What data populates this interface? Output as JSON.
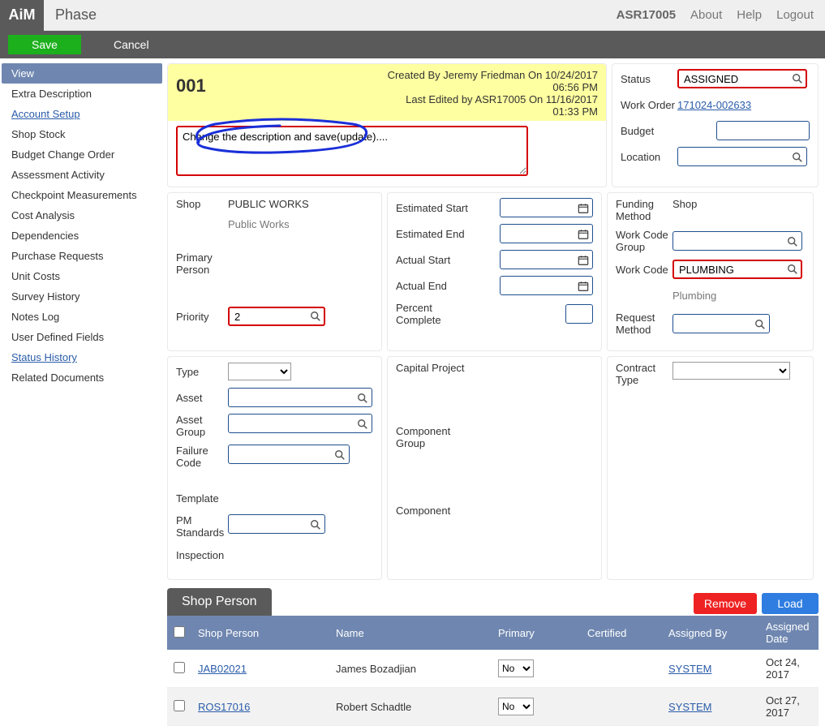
{
  "app": {
    "logo_a": "Ai",
    "logo_b": "M",
    "title": "Phase"
  },
  "top": {
    "user": "ASR17005",
    "about": "About",
    "help": "Help",
    "logout": "Logout"
  },
  "actions": {
    "save": "Save",
    "cancel": "Cancel"
  },
  "sidebar": {
    "view": "View",
    "items": [
      "Extra Description",
      "Account Setup",
      "Shop Stock",
      "Budget Change Order",
      "Assessment Activity",
      "Checkpoint Measurements",
      "Cost Analysis",
      "Dependencies",
      "Purchase Requests",
      "Unit Costs",
      "Survey History",
      "Notes Log",
      "User Defined Fields",
      "Status History",
      "Related Documents"
    ],
    "link_idx": [
      1,
      13
    ]
  },
  "header": {
    "phase": "001",
    "created": "Created By Jeremy Friedman On 10/24/2017",
    "created_time": "06:56 PM",
    "edited": "Last Edited by ASR17005 On 11/16/2017",
    "edited_time": "01:33 PM",
    "description": "Change the description and save(update)...."
  },
  "status_panel": {
    "status_lbl": "Status",
    "status_val": "ASSIGNED",
    "wo_lbl": "Work Order",
    "wo_val": "171024-002633",
    "budget_lbl": "Budget",
    "location_lbl": "Location"
  },
  "shop_panel": {
    "shop_lbl": "Shop",
    "shop_val": "PUBLIC WORKS",
    "shop_sub": "Public Works",
    "primary_lbl": "Primary Person",
    "priority_lbl": "Priority",
    "priority_val": "2"
  },
  "dates_panel": {
    "est_start": "Estimated Start",
    "est_end": "Estimated End",
    "act_start": "Actual Start",
    "act_end": "Actual End",
    "pct": "Percent Complete"
  },
  "funding_panel": {
    "funding_lbl": "Funding Method",
    "funding_val": "Shop",
    "wcg_lbl": "Work Code Group",
    "wc_lbl": "Work Code",
    "wc_val": "PLUMBING",
    "wc_sub": "Plumbing",
    "req_lbl": "Request Method"
  },
  "type_panel": {
    "type_lbl": "Type",
    "asset_lbl": "Asset",
    "asset_grp_lbl": "Asset Group",
    "failure_lbl": "Failure Code",
    "template_lbl": "Template",
    "pm_lbl": "PM Standards",
    "insp_lbl": "Inspection"
  },
  "capital_panel": {
    "cap_lbl": "Capital Project",
    "comp_grp_lbl": "Component Group",
    "comp_lbl": "Component"
  },
  "contract_panel": {
    "contract_lbl": "Contract Type"
  },
  "shop_person": {
    "tab": "Shop Person",
    "remove": "Remove",
    "load": "Load",
    "cols": {
      "sp": "Shop Person",
      "name": "Name",
      "primary": "Primary",
      "cert": "Certified",
      "by": "Assigned By",
      "date": "Assigned Date"
    },
    "rows": [
      {
        "id": "JAB02021",
        "name": "James Bozadjian",
        "primary": "No",
        "by": "SYSTEM",
        "date": "Oct 24, 2017"
      },
      {
        "id": "ROS17016",
        "name": "Robert Schadtle",
        "primary": "No",
        "by": "SYSTEM",
        "date": "Oct 27, 2017"
      }
    ]
  }
}
